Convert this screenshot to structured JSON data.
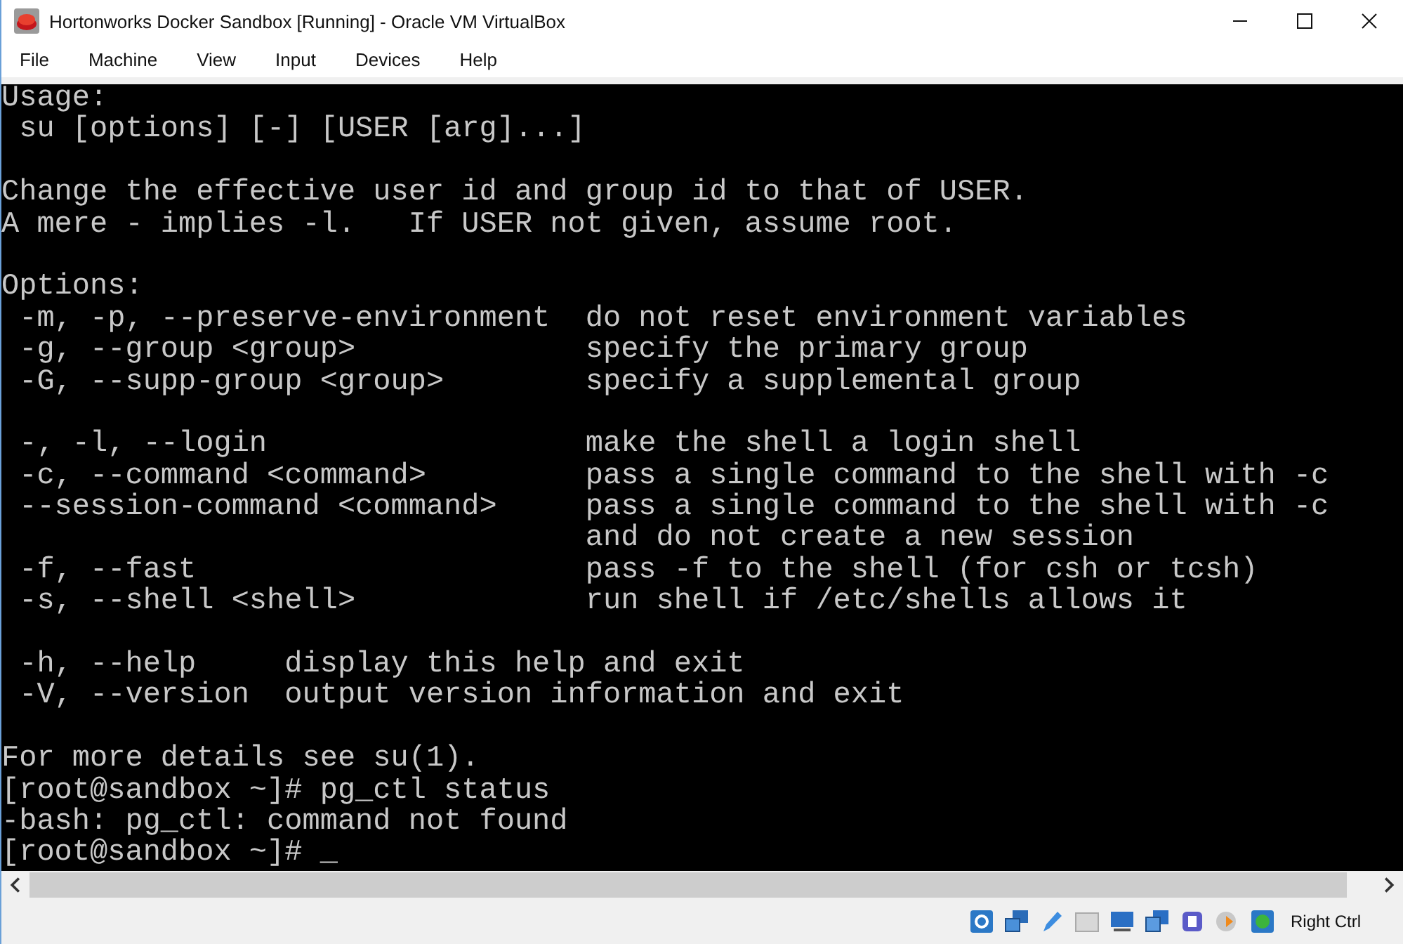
{
  "window": {
    "title": "Hortonworks Docker Sandbox [Running] - Oracle VM VirtualBox"
  },
  "menu": [
    "File",
    "Machine",
    "View",
    "Input",
    "Devices",
    "Help"
  ],
  "terminal": {
    "blocks": [
      [
        "Usage:",
        " su [options] [-] [USER [arg]...]"
      ],
      [
        "Change the effective user id and group id to that of USER.",
        "A mere - implies -l.   If USER not given, assume root."
      ],
      [
        "Options:",
        " -m, -p, --preserve-environment  do not reset environment variables",
        " -g, --group <group>             specify the primary group",
        " -G, --supp-group <group>        specify a supplemental group"
      ],
      [
        " -, -l, --login                  make the shell a login shell",
        " -c, --command <command>         pass a single command to the shell with -c",
        " --session-command <command>     pass a single command to the shell with -c",
        "                                 and do not create a new session",
        " -f, --fast                      pass -f to the shell (for csh or tcsh)",
        " -s, --shell <shell>             run shell if /etc/shells allows it"
      ],
      [
        " -h, --help     display this help and exit",
        " -V, --version  output version information and exit"
      ],
      [
        "For more details see su(1).",
        "[root@sandbox ~]# pg_ctl status",
        "-bash: pg_ctl: command not found",
        "[root@sandbox ~]# _"
      ]
    ]
  },
  "status_bar": {
    "host_key": "Right Ctrl"
  }
}
